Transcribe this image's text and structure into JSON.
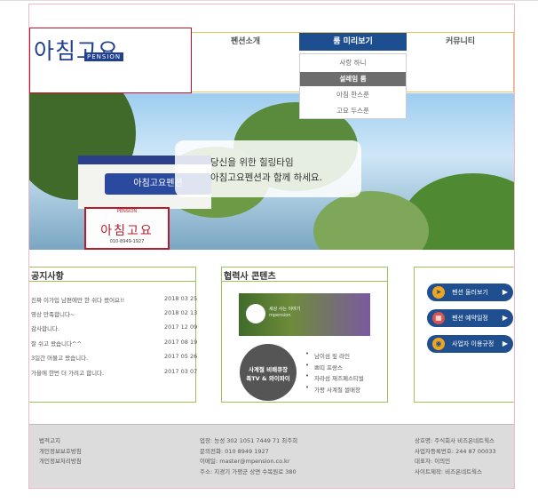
{
  "logo": {
    "korean": "아침고요",
    "pension": "PENSION"
  },
  "nav": {
    "items": [
      "펜션소개",
      "룸 미리보기",
      "커뮤니티"
    ],
    "active_index": 1
  },
  "dropdown": {
    "items": [
      "사랑 하니",
      "설레임 룸",
      "아침 한스푼",
      "고요 두스푼"
    ],
    "active_index": 1
  },
  "hero": {
    "line1": "당신을 위한 힐링타임",
    "line2": "아침고요펜션과 함께 하세요.",
    "sign_top": "아침고요펜션",
    "sign_name": "아침고요",
    "sign_pension": "PENSION",
    "sign_phone": "010-8949-1927"
  },
  "notice": {
    "title": "공지사항",
    "rows": [
      {
        "title": "진짜 이가입 남편에만 한 쉬다 왔어요!!",
        "date": "2018 03 25"
      },
      {
        "title": "영상 만족합니다~",
        "date": "2018 02 13"
      },
      {
        "title": "감사합니다.",
        "date": "2017 12 09"
      },
      {
        "title": "잘 쉬고 왔습니다^^",
        "date": "2017 08 19"
      },
      {
        "title": "3일간 머물고 왔습니다.",
        "date": "2017 05 26"
      },
      {
        "title": "가을에 한번 더 가려고 합니다.",
        "date": "2017 03 07"
      }
    ]
  },
  "partner": {
    "title": "협력사 콘텐츠",
    "banner_line1": "세상 사는 이야기",
    "banner_line2": "mpension",
    "circle_line1": "사계절 비배큐장",
    "circle_line2": "족TV & 와이파이",
    "list": [
      "남이섬 짚 라인",
      "쁘띠 프랑스",
      "자라섬 재즈페스티벌",
      "가평 사계절 썰매장"
    ]
  },
  "quick": {
    "buttons": [
      {
        "label": "펜션 둘러보기",
        "icon": "compass-icon"
      },
      {
        "label": "펜션 예약일정",
        "icon": "calendar-icon"
      },
      {
        "label": "사업자 이용규정",
        "icon": "info-icon"
      }
    ]
  },
  "footer": {
    "col1": [
      "법적고지",
      "개인정보보호방침",
      "개인정보처리방침"
    ],
    "col2": [
      "업장: 능성 302 1051 7449 71 최주희",
      "문의전화: 010 8949 1927",
      "이메일: master@mpension.co.kr",
      "주소: 지경기 가평군 상면 수목원로 380"
    ],
    "col3": [
      "상호명: 주식회사 비즈온네트웍스",
      "사업자등록번호: 244 87 00033",
      "대표자: 이의민",
      "사이트제작: 비즈온네트웍스"
    ]
  },
  "colors": {
    "nav_active": "#1d4e8f",
    "border_green": "#9bc55b",
    "logo_red": "#c8102e",
    "quick_blue": "#1f4f8f"
  }
}
